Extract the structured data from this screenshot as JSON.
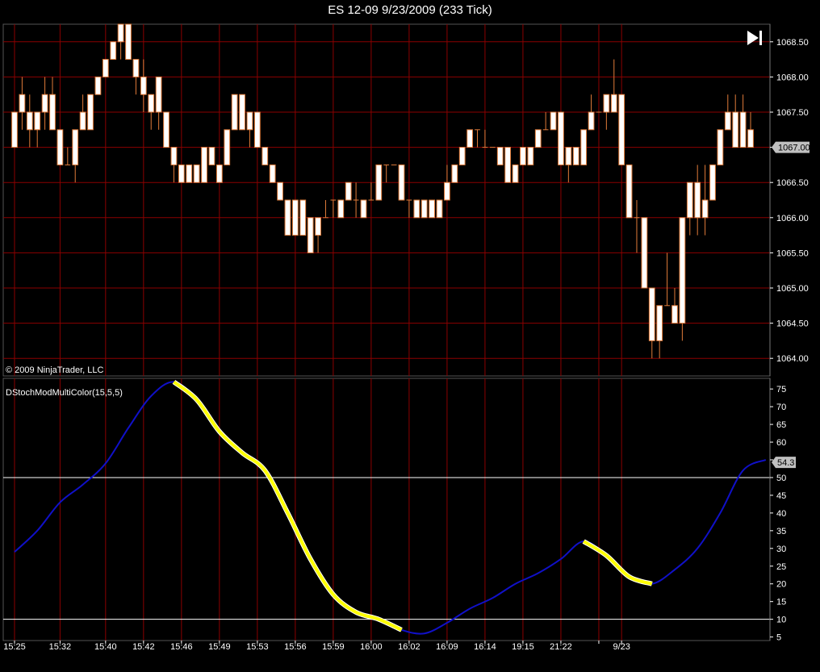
{
  "window_title": "ES 12-09  9/23/2009 (233 Tick)",
  "copyright": "© 2009 NinjaTrader, LLC",
  "colors": {
    "background": "#000000",
    "grid": "#8b0000",
    "candle_body": "#ffffff",
    "candle_outline": "#e07b39",
    "wick": "#e07b39",
    "stoch_up": "#1010c8",
    "stoch_down": "#ffff00",
    "level_line": "#ffffff",
    "badge": "#c0c0c0"
  },
  "chart_data": [
    {
      "type": "candlestick",
      "title": "ES 12-09  9/23/2009 (233 Tick)",
      "ylim": [
        1063.75,
        1068.75
      ],
      "y_ticks": [
        "1068.50",
        "1068.00",
        "1067.50",
        "1067.00",
        "1066.50",
        "1066.00",
        "1065.50",
        "1065.00",
        "1064.50",
        "1064.00"
      ],
      "last_price": "1067.00",
      "candles": [
        {
          "o": 1067.0,
          "h": 1067.5,
          "l": 1067.0,
          "c": 1067.5
        },
        {
          "o": 1067.5,
          "h": 1068.0,
          "l": 1067.25,
          "c": 1067.75
        },
        {
          "o": 1067.5,
          "h": 1067.75,
          "l": 1067.0,
          "c": 1067.25
        },
        {
          "o": 1067.25,
          "h": 1067.5,
          "l": 1067.0,
          "c": 1067.5
        },
        {
          "o": 1067.5,
          "h": 1068.0,
          "l": 1067.25,
          "c": 1067.75
        },
        {
          "o": 1067.75,
          "h": 1068.0,
          "l": 1067.25,
          "c": 1067.25
        },
        {
          "o": 1067.25,
          "h": 1067.25,
          "l": 1066.75,
          "c": 1066.75
        },
        {
          "o": 1066.75,
          "h": 1067.0,
          "l": 1066.75,
          "c": 1066.75
        },
        {
          "o": 1066.75,
          "h": 1067.25,
          "l": 1066.5,
          "c": 1067.25
        },
        {
          "o": 1067.25,
          "h": 1067.75,
          "l": 1067.25,
          "c": 1067.5
        },
        {
          "o": 1067.25,
          "h": 1067.75,
          "l": 1067.25,
          "c": 1067.75
        },
        {
          "o": 1067.75,
          "h": 1068.0,
          "l": 1067.75,
          "c": 1068.0
        },
        {
          "o": 1068.0,
          "h": 1068.25,
          "l": 1068.0,
          "c": 1068.25
        },
        {
          "o": 1068.25,
          "h": 1068.5,
          "l": 1068.25,
          "c": 1068.5
        },
        {
          "o": 1068.5,
          "h": 1068.75,
          "l": 1068.25,
          "c": 1068.75
        },
        {
          "o": 1068.75,
          "h": 1068.75,
          "l": 1068.25,
          "c": 1068.25
        },
        {
          "o": 1068.25,
          "h": 1068.25,
          "l": 1067.75,
          "c": 1068.0
        },
        {
          "o": 1068.0,
          "h": 1068.25,
          "l": 1067.5,
          "c": 1067.75
        },
        {
          "o": 1067.75,
          "h": 1067.75,
          "l": 1067.25,
          "c": 1067.5
        },
        {
          "o": 1067.5,
          "h": 1068.0,
          "l": 1067.25,
          "c": 1068.0
        },
        {
          "o": 1067.5,
          "h": 1067.5,
          "l": 1067.0,
          "c": 1067.0
        },
        {
          "o": 1067.0,
          "h": 1067.0,
          "l": 1066.5,
          "c": 1066.75
        },
        {
          "o": 1066.75,
          "h": 1066.75,
          "l": 1066.5,
          "c": 1066.5
        },
        {
          "o": 1066.5,
          "h": 1066.75,
          "l": 1066.5,
          "c": 1066.75
        },
        {
          "o": 1066.75,
          "h": 1066.75,
          "l": 1066.5,
          "c": 1066.5
        },
        {
          "o": 1066.5,
          "h": 1067.0,
          "l": 1066.5,
          "c": 1067.0
        },
        {
          "o": 1067.0,
          "h": 1067.0,
          "l": 1066.75,
          "c": 1066.75
        },
        {
          "o": 1066.75,
          "h": 1066.75,
          "l": 1066.5,
          "c": 1066.5
        },
        {
          "o": 1066.75,
          "h": 1067.25,
          "l": 1066.75,
          "c": 1067.25
        },
        {
          "o": 1067.25,
          "h": 1067.75,
          "l": 1067.25,
          "c": 1067.75
        },
        {
          "o": 1067.75,
          "h": 1067.75,
          "l": 1067.25,
          "c": 1067.25
        },
        {
          "o": 1067.25,
          "h": 1067.5,
          "l": 1067.0,
          "c": 1067.5
        },
        {
          "o": 1067.5,
          "h": 1067.5,
          "l": 1067.0,
          "c": 1067.0
        },
        {
          "o": 1067.0,
          "h": 1067.0,
          "l": 1066.75,
          "c": 1066.75
        },
        {
          "o": 1066.75,
          "h": 1066.75,
          "l": 1066.5,
          "c": 1066.5
        },
        {
          "o": 1066.5,
          "h": 1066.5,
          "l": 1066.25,
          "c": 1066.25
        },
        {
          "o": 1066.25,
          "h": 1066.25,
          "l": 1065.75,
          "c": 1065.75
        },
        {
          "o": 1066.25,
          "h": 1066.25,
          "l": 1065.75,
          "c": 1065.75
        },
        {
          "o": 1066.25,
          "h": 1066.25,
          "l": 1065.75,
          "c": 1065.75
        },
        {
          "o": 1066.0,
          "h": 1066.0,
          "l": 1065.5,
          "c": 1065.5
        },
        {
          "o": 1065.75,
          "h": 1066.0,
          "l": 1065.5,
          "c": 1066.0
        },
        {
          "o": 1066.0,
          "h": 1066.25,
          "l": 1066.0,
          "c": 1066.0
        },
        {
          "o": 1066.25,
          "h": 1066.25,
          "l": 1066.0,
          "c": 1066.25
        },
        {
          "o": 1066.0,
          "h": 1066.25,
          "l": 1066.0,
          "c": 1066.25
        },
        {
          "o": 1066.25,
          "h": 1066.5,
          "l": 1066.25,
          "c": 1066.5
        },
        {
          "o": 1066.25,
          "h": 1066.5,
          "l": 1066.0,
          "c": 1066.25
        },
        {
          "o": 1066.25,
          "h": 1066.25,
          "l": 1066.0,
          "c": 1066.0
        },
        {
          "o": 1066.25,
          "h": 1066.5,
          "l": 1066.25,
          "c": 1066.25
        },
        {
          "o": 1066.25,
          "h": 1066.75,
          "l": 1066.25,
          "c": 1066.75
        },
        {
          "o": 1066.75,
          "h": 1066.75,
          "l": 1066.5,
          "c": 1066.75
        },
        {
          "o": 1066.75,
          "h": 1066.75,
          "l": 1066.75,
          "c": 1066.75
        },
        {
          "o": 1066.75,
          "h": 1066.75,
          "l": 1066.25,
          "c": 1066.25
        },
        {
          "o": 1066.25,
          "h": 1066.25,
          "l": 1066.0,
          "c": 1066.25
        },
        {
          "o": 1066.25,
          "h": 1066.25,
          "l": 1066.0,
          "c": 1066.0
        },
        {
          "o": 1066.0,
          "h": 1066.25,
          "l": 1066.0,
          "c": 1066.25
        },
        {
          "o": 1066.25,
          "h": 1066.25,
          "l": 1066.0,
          "c": 1066.0
        },
        {
          "o": 1066.0,
          "h": 1066.25,
          "l": 1066.0,
          "c": 1066.25
        },
        {
          "o": 1066.25,
          "h": 1066.75,
          "l": 1066.25,
          "c": 1066.5
        },
        {
          "o": 1066.5,
          "h": 1066.75,
          "l": 1066.5,
          "c": 1066.75
        },
        {
          "o": 1066.75,
          "h": 1067.0,
          "l": 1066.75,
          "c": 1067.0
        },
        {
          "o": 1067.0,
          "h": 1067.25,
          "l": 1067.0,
          "c": 1067.25
        },
        {
          "o": 1067.25,
          "h": 1067.25,
          "l": 1067.0,
          "c": 1067.25
        },
        {
          "o": 1067.0,
          "h": 1067.25,
          "l": 1067.0,
          "c": 1067.0
        },
        {
          "o": 1067.0,
          "h": 1067.0,
          "l": 1067.0,
          "c": 1067.0
        },
        {
          "o": 1067.0,
          "h": 1067.0,
          "l": 1066.75,
          "c": 1066.75
        },
        {
          "o": 1067.0,
          "h": 1067.0,
          "l": 1066.5,
          "c": 1066.5
        },
        {
          "o": 1066.5,
          "h": 1066.75,
          "l": 1066.5,
          "c": 1066.75
        },
        {
          "o": 1066.75,
          "h": 1067.0,
          "l": 1066.75,
          "c": 1067.0
        },
        {
          "o": 1066.75,
          "h": 1067.0,
          "l": 1066.75,
          "c": 1067.0
        },
        {
          "o": 1067.0,
          "h": 1067.25,
          "l": 1067.0,
          "c": 1067.25
        },
        {
          "o": 1067.25,
          "h": 1067.5,
          "l": 1067.25,
          "c": 1067.25
        },
        {
          "o": 1067.25,
          "h": 1067.5,
          "l": 1067.25,
          "c": 1067.5
        },
        {
          "o": 1067.5,
          "h": 1067.5,
          "l": 1066.75,
          "c": 1066.75
        },
        {
          "o": 1066.75,
          "h": 1067.0,
          "l": 1066.5,
          "c": 1067.0
        },
        {
          "o": 1067.0,
          "h": 1067.0,
          "l": 1066.75,
          "c": 1066.75
        },
        {
          "o": 1066.75,
          "h": 1067.25,
          "l": 1066.75,
          "c": 1067.25
        },
        {
          "o": 1067.25,
          "h": 1067.75,
          "l": 1067.25,
          "c": 1067.5
        },
        {
          "o": 1067.5,
          "h": 1067.5,
          "l": 1067.5,
          "c": 1067.5
        },
        {
          "o": 1067.5,
          "h": 1067.75,
          "l": 1067.25,
          "c": 1067.75
        },
        {
          "o": 1067.75,
          "h": 1068.25,
          "l": 1067.5,
          "c": 1067.5
        },
        {
          "o": 1067.75,
          "h": 1067.75,
          "l": 1066.75,
          "c": 1066.75
        },
        {
          "o": 1066.75,
          "h": 1066.75,
          "l": 1066.0,
          "c": 1066.0
        },
        {
          "o": 1066.0,
          "h": 1066.25,
          "l": 1065.5,
          "c": 1066.0
        },
        {
          "o": 1066.0,
          "h": 1066.0,
          "l": 1065.0,
          "c": 1065.0
        },
        {
          "o": 1065.0,
          "h": 1065.0,
          "l": 1064.0,
          "c": 1064.25
        },
        {
          "o": 1064.25,
          "h": 1064.75,
          "l": 1064.0,
          "c": 1064.75
        },
        {
          "o": 1064.75,
          "h": 1065.5,
          "l": 1064.75,
          "c": 1064.75
        },
        {
          "o": 1064.75,
          "h": 1065.0,
          "l": 1064.5,
          "c": 1064.5
        },
        {
          "o": 1064.5,
          "h": 1064.75,
          "l": 1064.25,
          "c": 1066.0
        },
        {
          "o": 1066.0,
          "h": 1066.5,
          "l": 1065.75,
          "c": 1066.5
        },
        {
          "o": 1066.5,
          "h": 1066.75,
          "l": 1065.75,
          "c": 1066.0
        },
        {
          "o": 1066.0,
          "h": 1066.75,
          "l": 1065.75,
          "c": 1066.25
        },
        {
          "o": 1066.25,
          "h": 1066.75,
          "l": 1066.25,
          "c": 1066.75
        },
        {
          "o": 1066.75,
          "h": 1067.25,
          "l": 1066.75,
          "c": 1067.25
        },
        {
          "o": 1067.25,
          "h": 1067.75,
          "l": 1067.25,
          "c": 1067.5
        },
        {
          "o": 1067.5,
          "h": 1067.75,
          "l": 1067.0,
          "c": 1067.0
        },
        {
          "o": 1067.0,
          "h": 1067.75,
          "l": 1067.0,
          "c": 1067.5
        },
        {
          "o": 1067.25,
          "h": 1067.5,
          "l": 1067.0,
          "c": 1067.0
        }
      ]
    },
    {
      "type": "line",
      "title": "DStochModMultiColor(15,5,5)",
      "ylim": [
        4,
        78
      ],
      "y_ticks": [
        "75",
        "70",
        "65",
        "60",
        "55",
        "50",
        "45",
        "40",
        "35",
        "30",
        "25",
        "20",
        "15",
        "10",
        "5"
      ],
      "levels": [
        50,
        10
      ],
      "last_value": "54.3",
      "x": [
        0,
        3,
        6,
        9,
        12,
        15,
        18,
        21,
        24,
        27,
        30,
        33,
        36,
        39,
        42,
        45,
        48,
        51,
        54,
        57,
        60,
        63,
        66,
        69,
        72,
        75,
        78,
        81,
        84,
        87,
        90,
        93,
        96,
        99
      ],
      "values": [
        29,
        35,
        43,
        48,
        54,
        64,
        73,
        77,
        72,
        63,
        57,
        52,
        40,
        27,
        17,
        12,
        10,
        7,
        6,
        9,
        13,
        16,
        20,
        23,
        27,
        32,
        28,
        22,
        20,
        24,
        30,
        40,
        52,
        55
      ],
      "down_segments": [
        [
          21,
          51
        ],
        [
          75,
          84
        ]
      ],
      "x_ticks": [
        {
          "i": 0,
          "label": "15:25"
        },
        {
          "i": 6,
          "label": "15:32"
        },
        {
          "i": 12,
          "label": "15:40"
        },
        {
          "i": 17,
          "label": "15:42"
        },
        {
          "i": 22,
          "label": "15:46"
        },
        {
          "i": 27,
          "label": "15:49"
        },
        {
          "i": 32,
          "label": "15:53"
        },
        {
          "i": 37,
          "label": "15:56"
        },
        {
          "i": 42,
          "label": "15:59"
        },
        {
          "i": 47,
          "label": "16:00"
        },
        {
          "i": 52,
          "label": "16:02"
        },
        {
          "i": 57,
          "label": "16:09"
        },
        {
          "i": 62,
          "label": "16:14"
        },
        {
          "i": 67,
          "label": "19:15"
        },
        {
          "i": 72,
          "label": "21:22"
        },
        {
          "i": 77,
          "label": ""
        },
        {
          "i": 80,
          "label": "9/23"
        }
      ]
    }
  ]
}
